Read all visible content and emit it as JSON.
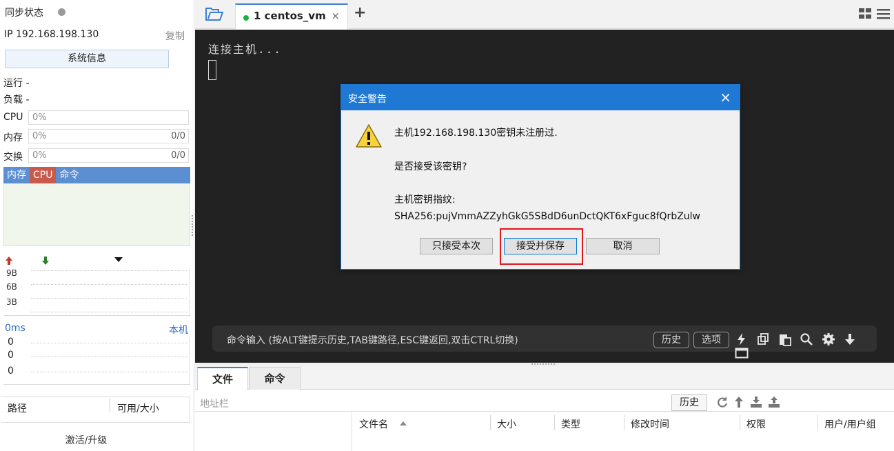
{
  "left": {
    "sync_status_label": "同步状态",
    "ip_label": "IP  192.168.198.130",
    "copy_label": "复制",
    "sysinfo_button": "系统信息",
    "running_label": "运行 -",
    "load_label": "负载 -",
    "cpu": {
      "label": "CPU",
      "value": "0%"
    },
    "mem": {
      "label": "内存",
      "value": "0%",
      "right": "0/0"
    },
    "swap": {
      "label": "交换",
      "value": "0%",
      "right": "0/0"
    },
    "monitor_tabs": [
      "内存",
      "CPU",
      "命令"
    ],
    "net_scale": [
      "9B",
      "6B",
      "3B"
    ],
    "ping_label": "0ms",
    "local_label": "本机",
    "ping_values": [
      "0",
      "0",
      "0"
    ],
    "path_header": {
      "path": "路径",
      "size": "可用/大小"
    },
    "activate_label": "激活/升级"
  },
  "topbar": {
    "tab_label": "1  centos_vm",
    "tab_close": "×",
    "new_tab": "+"
  },
  "terminal": {
    "line1": "连接主机...",
    "cmd_placeholder": "命令输入 (按ALT键提示历史,TAB键路径,ESC键返回,双击CTRL切换)",
    "history_btn": "历史",
    "options_btn": "选项"
  },
  "dialog": {
    "title": "安全警告",
    "close": "×",
    "line1": "主机192.168.198.130密钥未注册过.",
    "line2": "是否接受该密钥?",
    "line3": "主机密钥指纹:",
    "line4": "SHA256:pujVmmAZZyhGkG5SBdD6unDctQKT6xFguc8fQrbZulw",
    "btn_once": "只接受本次",
    "btn_save": "接受并保存",
    "btn_cancel": "取消"
  },
  "bottom": {
    "tabs": [
      "文件",
      "命令"
    ],
    "address_placeholder": "地址栏",
    "history_btn": "历史",
    "columns": [
      "文件名",
      "大小",
      "类型",
      "修改时间",
      "权限",
      "用户/用户组"
    ]
  },
  "colors": {
    "accent": "#1e78d4",
    "terminal_bg": "#222222",
    "highlight": "#e0161b",
    "status_online": "#19b33d"
  }
}
